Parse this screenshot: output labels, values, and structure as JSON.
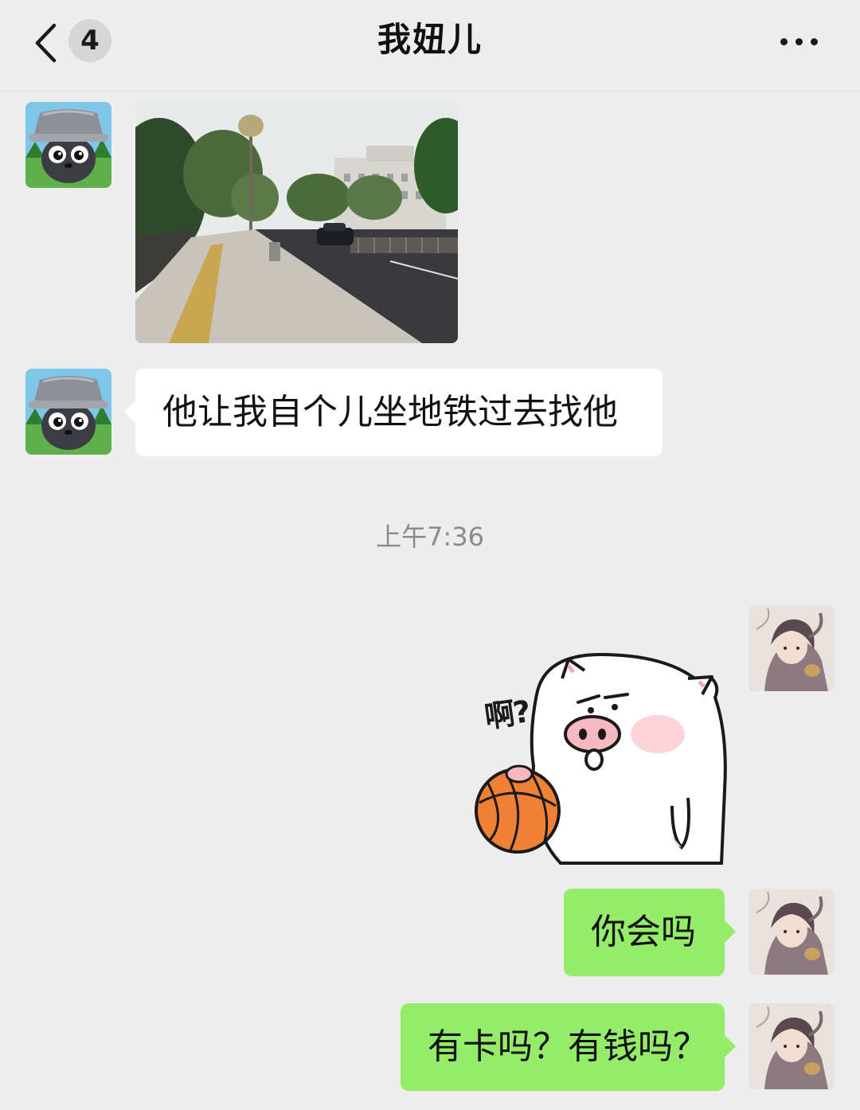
{
  "header": {
    "back_icon": "chevron-left-icon",
    "unread_count": "4",
    "title": "我妞儿",
    "more_icon": "more-dots-icon"
  },
  "messages": [
    {
      "sender": "other",
      "type": "image",
      "description_icon": "street-photo"
    },
    {
      "sender": "other",
      "type": "text",
      "text": "他让我自个儿坐地铁过去找他"
    },
    {
      "type": "timestamp",
      "text": "上午7:36"
    },
    {
      "sender": "me",
      "type": "sticker",
      "sticker_text": "啊?"
    },
    {
      "sender": "me",
      "type": "text",
      "text": "你会吗"
    },
    {
      "sender": "me",
      "type": "text",
      "text": "有卡吗？有钱吗？"
    }
  ],
  "colors": {
    "background": "#ededed",
    "bubble_out": "#95ec69",
    "bubble_in": "#ffffff",
    "timestamp": "#8a8a8a"
  }
}
